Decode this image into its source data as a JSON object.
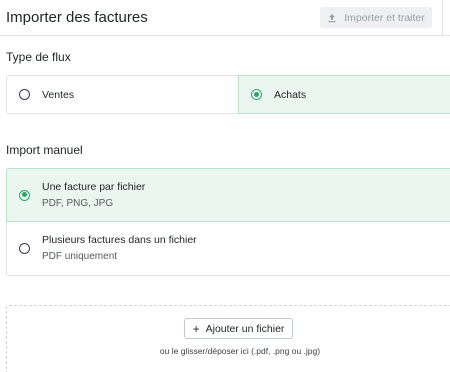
{
  "header": {
    "title": "Importer des factures",
    "import_button": "Importer et traiter"
  },
  "flux": {
    "title": "Type de flux",
    "options": [
      {
        "label": "Ventes",
        "selected": false
      },
      {
        "label": "Achats",
        "selected": true
      }
    ]
  },
  "import_manuel": {
    "title": "Import manuel",
    "options": [
      {
        "label": "Une facture par fichier",
        "sub": "PDF, PNG, JPG",
        "selected": true
      },
      {
        "label": "Plusieurs factures dans un fichier",
        "sub": "PDF uniquement",
        "selected": false
      }
    ]
  },
  "dropzone": {
    "add_button": "Ajouter un fichier",
    "hint": "ou le glisser/déposer ici (.pdf, .png ou .jpg)"
  },
  "colors": {
    "accent": "#2ea66a",
    "selected_bg": "#eaf6ef",
    "border": "#dfe2e6"
  }
}
